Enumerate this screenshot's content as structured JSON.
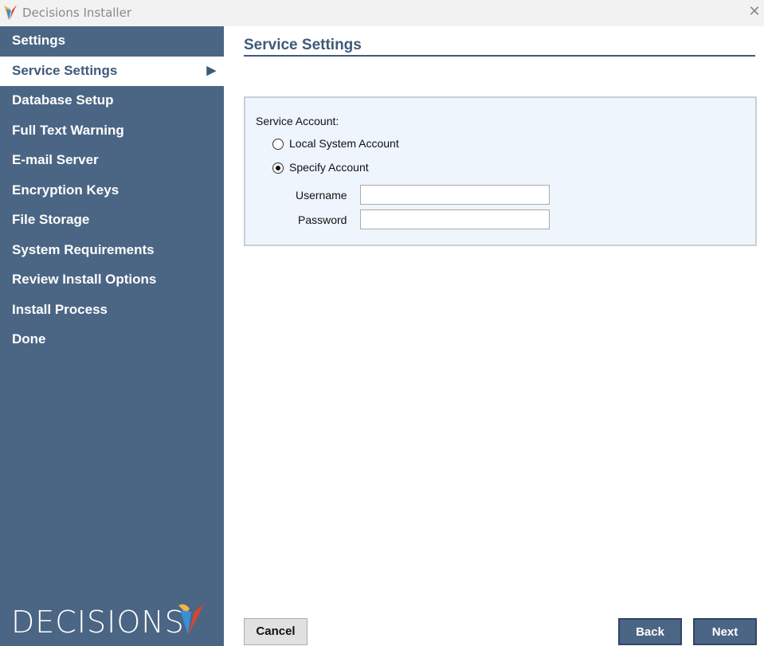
{
  "window": {
    "title": "Decisions Installer",
    "close_icon": "close-icon"
  },
  "sidebar": {
    "items": [
      {
        "label": "Settings"
      },
      {
        "label": "Service Settings",
        "active": true
      },
      {
        "label": "Database Setup"
      },
      {
        "label": "Full Text Warning"
      },
      {
        "label": "E-mail Server"
      },
      {
        "label": "Encryption Keys"
      },
      {
        "label": "File Storage"
      },
      {
        "label": "System Requirements"
      },
      {
        "label": "Review Install Options"
      },
      {
        "label": "Install Process"
      },
      {
        "label": "Done"
      }
    ],
    "brand": "DECISIONS"
  },
  "main": {
    "heading": "Service Settings",
    "service_account_label": "Service Account:",
    "options": [
      {
        "label": "Local System Account",
        "selected": false
      },
      {
        "label": "Specify Account",
        "selected": true
      }
    ],
    "username_label": "Username",
    "username_value": "",
    "password_label": "Password",
    "password_value": ""
  },
  "buttons": {
    "cancel": "Cancel",
    "back": "Back",
    "next": "Next"
  },
  "colors": {
    "sidebar": "#4b6584",
    "accent": "#3e5a7a",
    "panel": "#eef5fd"
  }
}
